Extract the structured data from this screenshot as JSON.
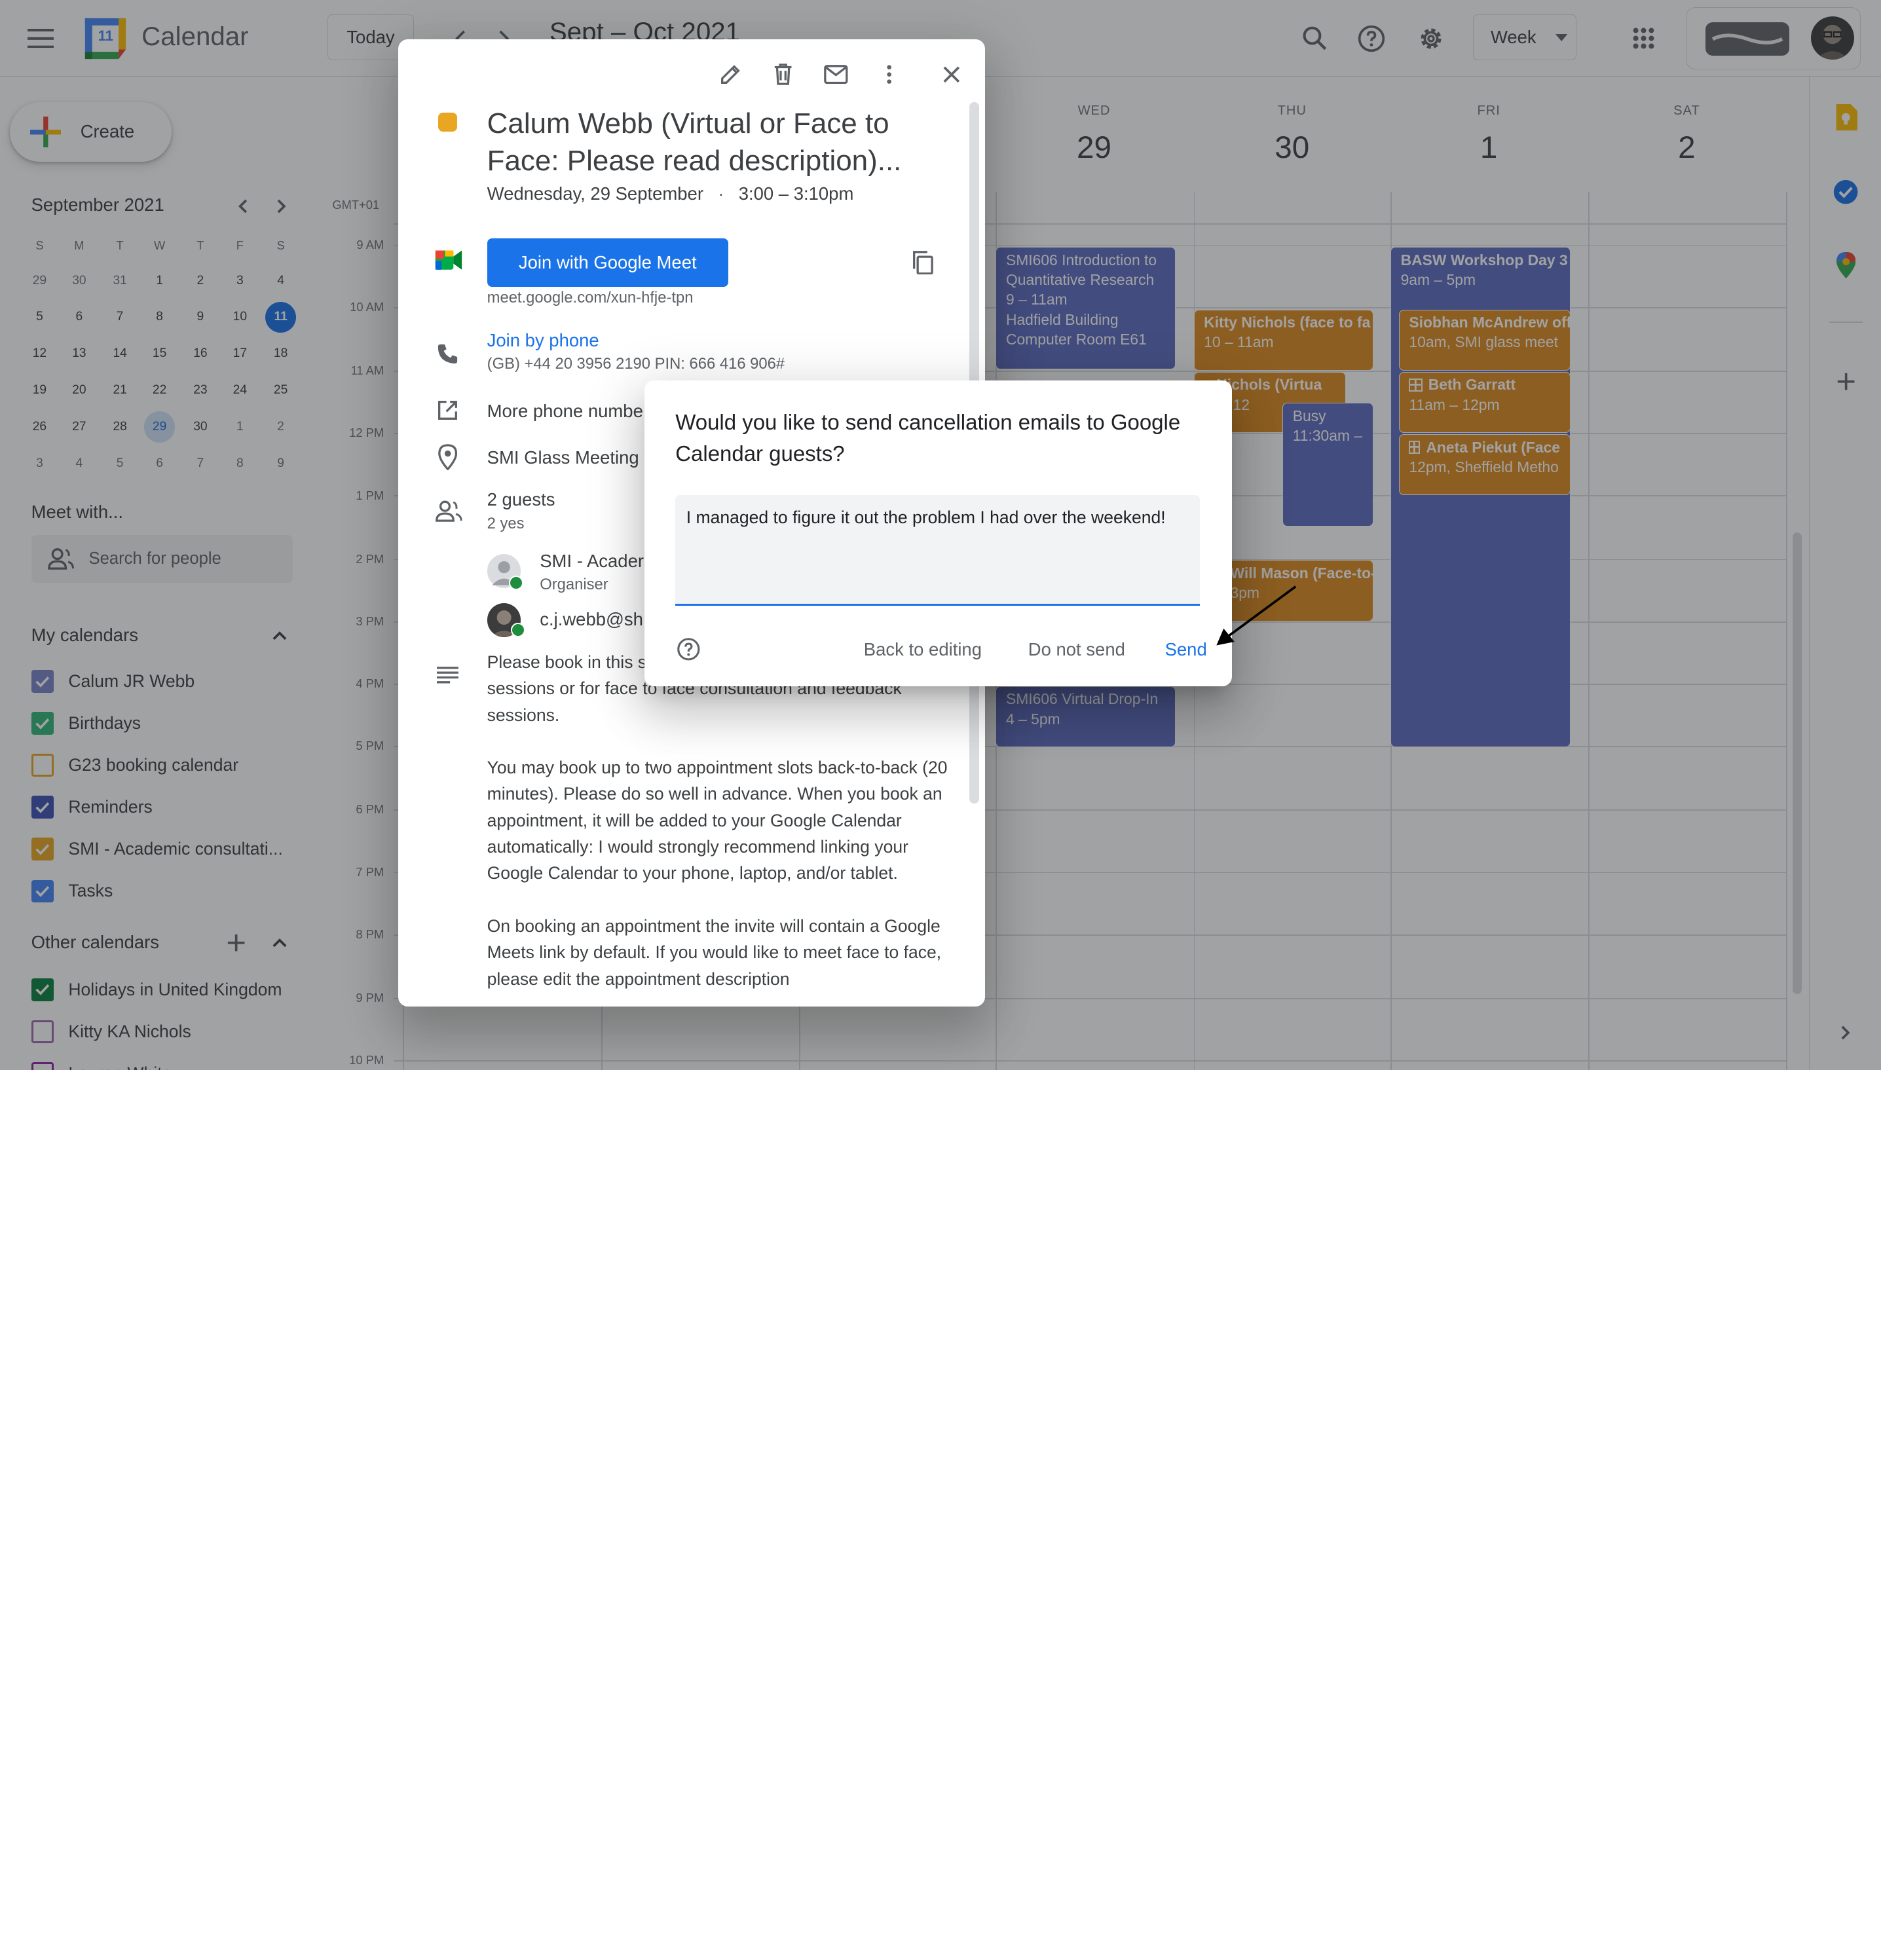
{
  "header": {
    "app_name": "Calendar",
    "calendar_logo_day": "11",
    "today_label": "Today",
    "date_range": "Sept – Oct 2021",
    "view_label": "Week"
  },
  "sidebar": {
    "create_label": "Create",
    "mini_cal": {
      "title": "September 2021",
      "dow": [
        "S",
        "M",
        "T",
        "W",
        "T",
        "F",
        "S"
      ],
      "weeks": [
        [
          "29",
          "30",
          "31",
          "1",
          "2",
          "3",
          "4"
        ],
        [
          "5",
          "6",
          "7",
          "8",
          "9",
          "10",
          "11"
        ],
        [
          "12",
          "13",
          "14",
          "15",
          "16",
          "17",
          "18"
        ],
        [
          "19",
          "20",
          "21",
          "22",
          "23",
          "24",
          "25"
        ],
        [
          "26",
          "27",
          "28",
          "29",
          "30",
          "1",
          "2"
        ],
        [
          "3",
          "4",
          "5",
          "6",
          "7",
          "8",
          "9"
        ]
      ]
    },
    "meet_with": "Meet with...",
    "search_people_placeholder": "Search for people",
    "my_calendars_title": "My calendars",
    "my_calendars": [
      {
        "label": "Calum JR Webb",
        "color": "#7986cb",
        "checked": true
      },
      {
        "label": "Birthdays",
        "color": "#33b679",
        "checked": true
      },
      {
        "label": "G23 booking calendar",
        "color": "#e8a623",
        "checked": false
      },
      {
        "label": "Reminders",
        "color": "#3f51b5",
        "checked": true
      },
      {
        "label": "SMI - Academic consultati...",
        "color": "#e8a623",
        "checked": true
      },
      {
        "label": "Tasks",
        "color": "#4285f4",
        "checked": true
      }
    ],
    "other_calendars_title": "Other calendars",
    "other_calendars": [
      {
        "label": "Holidays in United Kingdom",
        "color": "#0b8043",
        "checked": true
      },
      {
        "label": "Kitty KA Nichols",
        "color": "#9e69af",
        "checked": false
      },
      {
        "label": "Lauren White",
        "color": "#8e24aa",
        "checked": false
      }
    ]
  },
  "grid": {
    "timezone": "GMT+01",
    "hours": [
      "9 AM",
      "10 AM",
      "11 AM",
      "12 PM",
      "1 PM",
      "2 PM",
      "3 PM",
      "4 PM",
      "5 PM",
      "6 PM",
      "7 PM",
      "8 PM",
      "9 PM",
      "10 PM"
    ],
    "days": [
      {
        "dow": "WED",
        "num": "29"
      },
      {
        "dow": "THU",
        "num": "30"
      },
      {
        "dow": "FRI",
        "num": "1"
      },
      {
        "dow": "SAT",
        "num": "2"
      }
    ],
    "events": [
      {
        "title": "SMI606 Introduction to Quantitative Research",
        "line2": "9 – 11am",
        "line3": "Hadfield Building",
        "line4": "Computer Room E61"
      },
      {
        "title": "Kitty Nichols (face to fa",
        "line2": "10 – 11am"
      },
      {
        "title": "y Nichols (Virtua",
        "line2": "m – 12"
      },
      {
        "title": "Busy",
        "line2": "11:30am –"
      },
      {
        "title": "Will Mason (Face-to-",
        "line2": "3pm"
      },
      {
        "title": "SMI606 Virtual Drop-In",
        "line2": "4 – 5pm"
      },
      {
        "title": "BASW Workshop Day 3",
        "line2": "9am – 5pm"
      },
      {
        "title": "Siobhan McAndrew off",
        "line2": "10am, SMI glass meet"
      },
      {
        "title": "Beth Garratt",
        "line2": "11am – 12pm"
      },
      {
        "title": "Aneta Piekut (Face",
        "line2": "12pm, Sheffield Metho"
      }
    ]
  },
  "event_popup": {
    "title": "Calum Webb (Virtual or Face to Face: Please read description)...",
    "date": "Wednesday, 29 September",
    "time": "3:00 – 3:10pm",
    "meet_button": "Join with Google Meet",
    "meet_link": "meet.google.com/xun-hfje-tpn",
    "join_phone": "Join by phone",
    "phone_detail": "(GB) +44 20 3956 2190 PIN: 666 416 906#",
    "more_phone": "More phone numbe",
    "location": "SMI Glass Meeting",
    "guests_count": "2 guests",
    "guests_yes": "2 yes",
    "guest1_name": "SMI - Acader",
    "guest1_role": "Organiser",
    "guest2_name": "c.j.webb@sh",
    "description": [
      "Please book in this slot for virtual consultation and feedback sessions or for face to face consultation and feedback sessions.",
      "You may book up to two appointment slots back-to-back (20 minutes). Please do so well in advance. When you book an appointment, it will be added to your Google Calendar automatically: I would strongly recommend linking your Google Calendar to your phone, laptop, and/or tablet.",
      "On booking an appointment the invite will contain a Google Meets link by default. If you would like to meet face to face, please edit the appointment description"
    ]
  },
  "dialog": {
    "title": "Would you like to send cancellation emails to Google Calendar guests?",
    "message_value": "I managed to figure it out the problem I had over the weekend!",
    "back_label": "Back to editing",
    "dont_send_label": "Do not send",
    "send_label": "Send"
  },
  "colors": {
    "accent": "#1a73e8",
    "event_blue": "#5c6bc0",
    "event_orange": "#dd8a20",
    "today": "#1a73e8"
  }
}
